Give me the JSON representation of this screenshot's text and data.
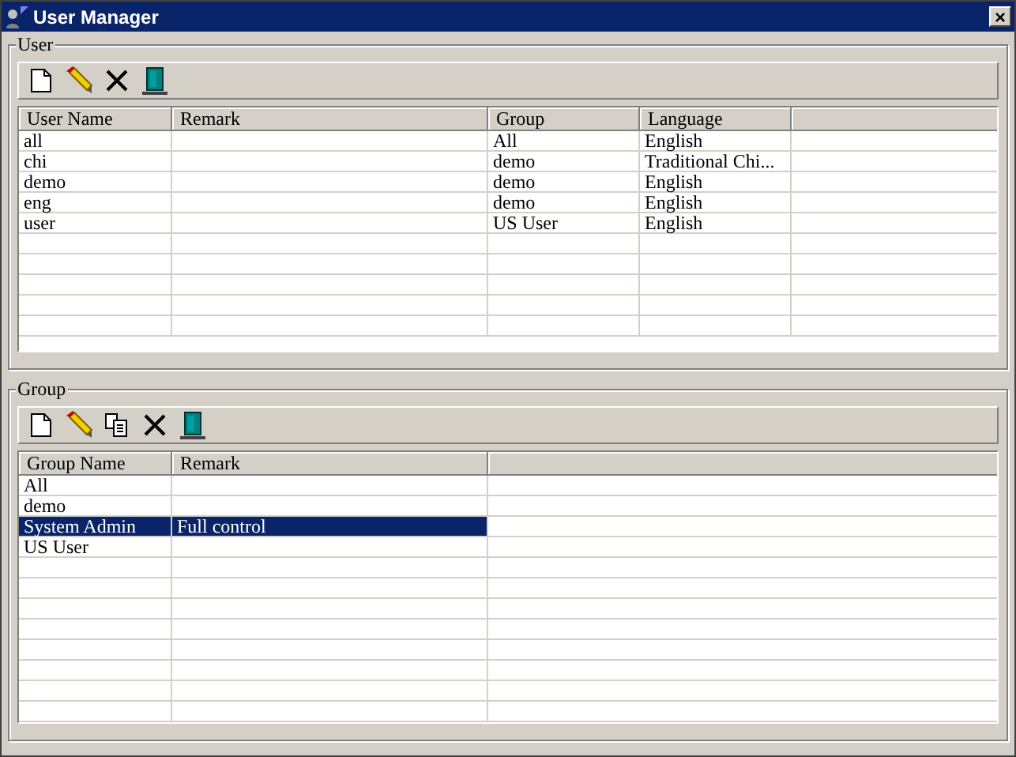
{
  "window": {
    "title": "User Manager",
    "close": "×"
  },
  "user": {
    "legend": "User",
    "toolbar": [
      {
        "kind": "new"
      },
      {
        "kind": "edit"
      },
      {
        "kind": "delete"
      },
      {
        "kind": "exit"
      }
    ],
    "columns": [
      "User Name",
      "Remark",
      "Group",
      "Language"
    ],
    "rows": [
      {
        "cells": [
          "all",
          "",
          "All",
          "English"
        ],
        "selected": false
      },
      {
        "cells": [
          "chi",
          "",
          "demo",
          "Traditional Chi..."
        ],
        "selected": false
      },
      {
        "cells": [
          "demo",
          "",
          "demo",
          "English"
        ],
        "selected": false
      },
      {
        "cells": [
          "eng",
          "",
          "demo",
          "English"
        ],
        "selected": false
      },
      {
        "cells": [
          "user",
          "",
          "US User",
          "English"
        ],
        "selected": false
      }
    ]
  },
  "group": {
    "legend": "Group",
    "toolbar": [
      {
        "kind": "new"
      },
      {
        "kind": "edit"
      },
      {
        "kind": "copy"
      },
      {
        "kind": "delete"
      },
      {
        "kind": "exit"
      }
    ],
    "columns": [
      "Group Name",
      "Remark"
    ],
    "rows": [
      {
        "cells": [
          "All",
          ""
        ],
        "selected": false
      },
      {
        "cells": [
          "demo",
          ""
        ],
        "selected": false
      },
      {
        "cells": [
          "System Admin",
          "Full control"
        ],
        "selected": true
      },
      {
        "cells": [
          "US User",
          ""
        ],
        "selected": false
      }
    ]
  }
}
